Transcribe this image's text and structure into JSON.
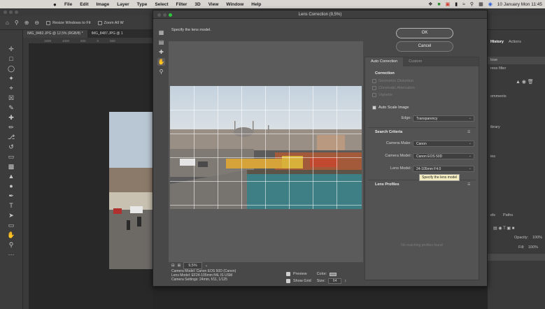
{
  "menubar": {
    "apple": "",
    "items": [
      "File",
      "Edit",
      "Image",
      "Layer",
      "Type",
      "Select",
      "Filter",
      "3D",
      "View",
      "Window",
      "Help"
    ],
    "datetime": "10 January Mon 11:45"
  },
  "optbar": {
    "resize_windows_label": "Resize Windows to Fit",
    "zoom_all_label": "Zoom All W"
  },
  "doc_tabs": [
    "IMG_8482.JPG @ 12.5% (RGB/8) *",
    "IMG_8487.JPG @ 1"
  ],
  "ruler_ticks": [
    "1500",
    "1000",
    "500",
    "0",
    "500"
  ],
  "right_panel": {
    "tabs": [
      "History",
      "Actions"
    ],
    "rows": [
      "lose",
      "ress filter"
    ],
    "section_labels": [
      "omments",
      "ibrary",
      "ies",
      "els",
      "Paths"
    ],
    "opacity_label": "Opacity:",
    "opacity_value": "100%",
    "fill_label": "Fill:",
    "fill_value": "100%"
  },
  "dialog": {
    "title": "Lens Correction (9,5%)",
    "hint": "Specify the lens model.",
    "ok_label": "OK",
    "cancel_label": "Cancel",
    "tabs": [
      "Auto Correction",
      "Custom"
    ],
    "correction_title": "Correction",
    "correction_options": [
      {
        "label": "Geometric Distortion",
        "checked": false
      },
      {
        "label": "Chromatic Aberration",
        "checked": false
      },
      {
        "label": "Vignette",
        "checked": false
      }
    ],
    "auto_scale_label": "Auto Scale Image",
    "edge_label": "Edge:",
    "edge_value": "Transparency",
    "search_title": "Search Criteria",
    "camera_make_label": "Camera Make:",
    "camera_make_value": "Canon",
    "camera_model_label": "Camera Model:",
    "camera_model_value": "Canon EOS 50D",
    "lens_model_label": "Lens Model:",
    "lens_model_value": "24-105mm F4.0",
    "tooltip": "Specify the lens model",
    "profiles_title": "Lens Profiles",
    "no_profiles": "No matching profiles found",
    "zoom_value": "9,5%",
    "camera_info": [
      "Camera Model: Canon EOS 50D (Canon)",
      "Lens Model: EF24-105mm f/4L IS USM",
      "Camera Settings: 24mm, f/11, 1/125"
    ],
    "preview_label": "Preview",
    "color_label": "Color:",
    "show_grid_label": "Show Grid",
    "size_label": "Size:",
    "size_value": "64"
  },
  "colors": {
    "foreground": "#d32f2f",
    "background": "#ffffff",
    "accent_ok": "#b5b5b5"
  }
}
